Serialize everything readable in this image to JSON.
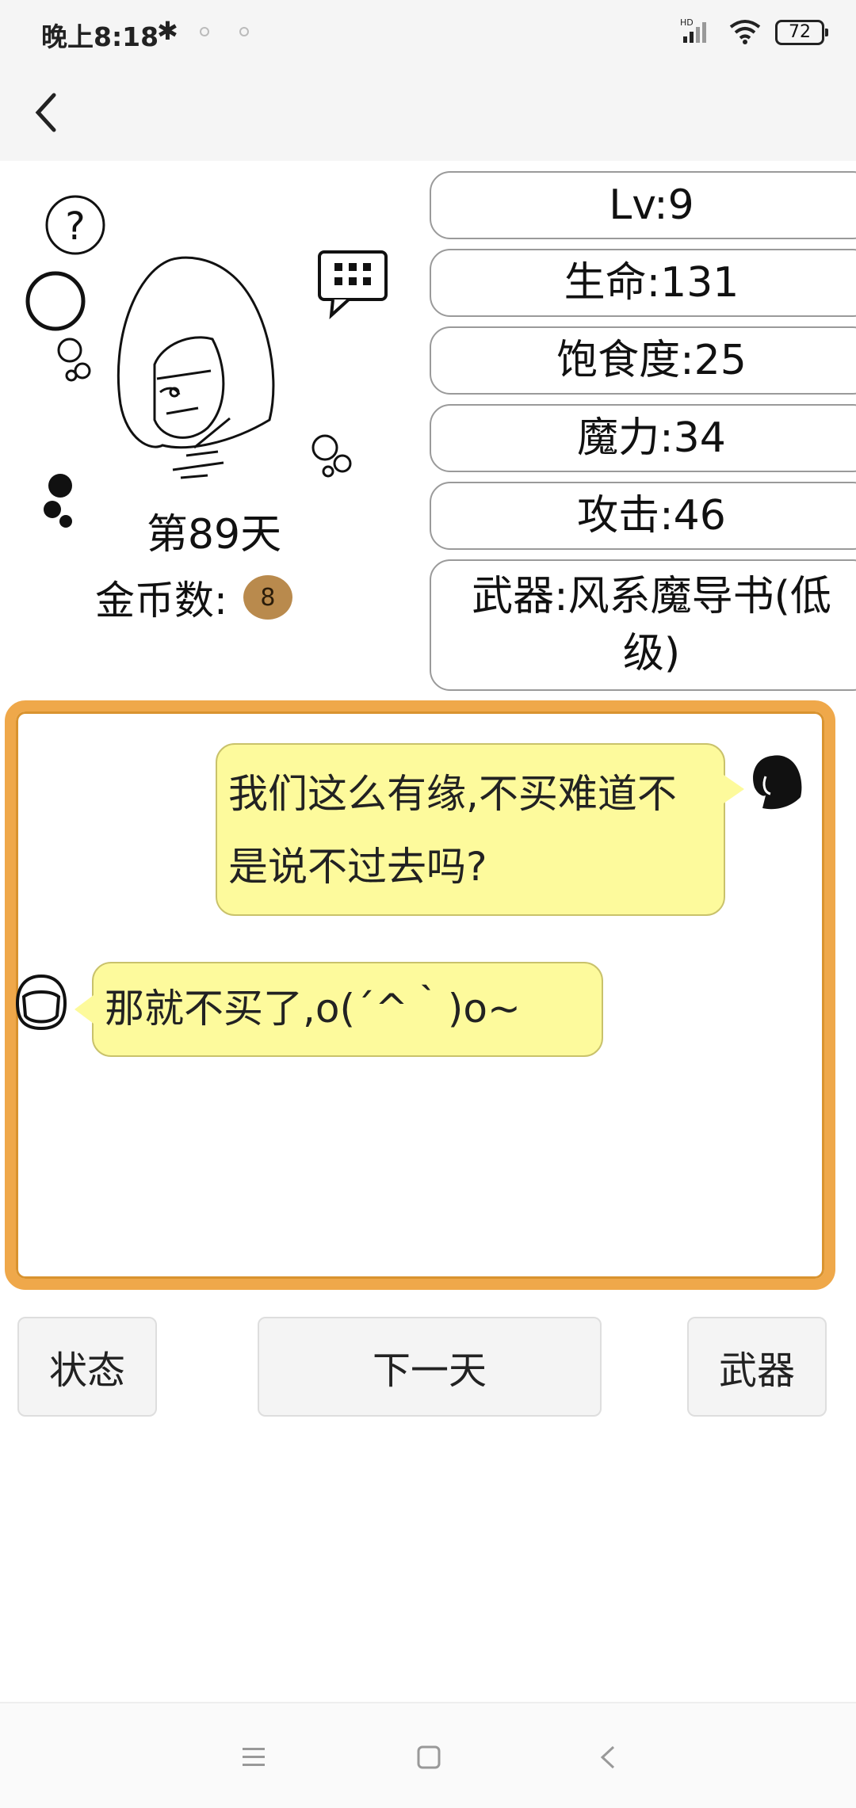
{
  "status_bar": {
    "time": "晚上8:18",
    "battery": "72",
    "network_label": "HD"
  },
  "stats": {
    "level": "Lv:9",
    "hp": "生命:131",
    "satiety": "饱食度:25",
    "mana": "魔力:34",
    "attack": "攻击:46",
    "weapon": "武器:风系魔导书(低级)"
  },
  "character": {
    "day": "第89天",
    "coins_label": "金币数:",
    "coins_value": "8"
  },
  "dialog": {
    "merchant_message": "我们这么有缘,不买难道不是说不过去吗?",
    "player_message": "那就不买了,o(´^｀)o~"
  },
  "buttons": {
    "status": "状态",
    "next_day": "下一天",
    "weapon": "武器"
  },
  "colors": {
    "dialog_border": "#efa84a",
    "bubble": "#fdfa9c",
    "coin": "#b98a4d"
  }
}
